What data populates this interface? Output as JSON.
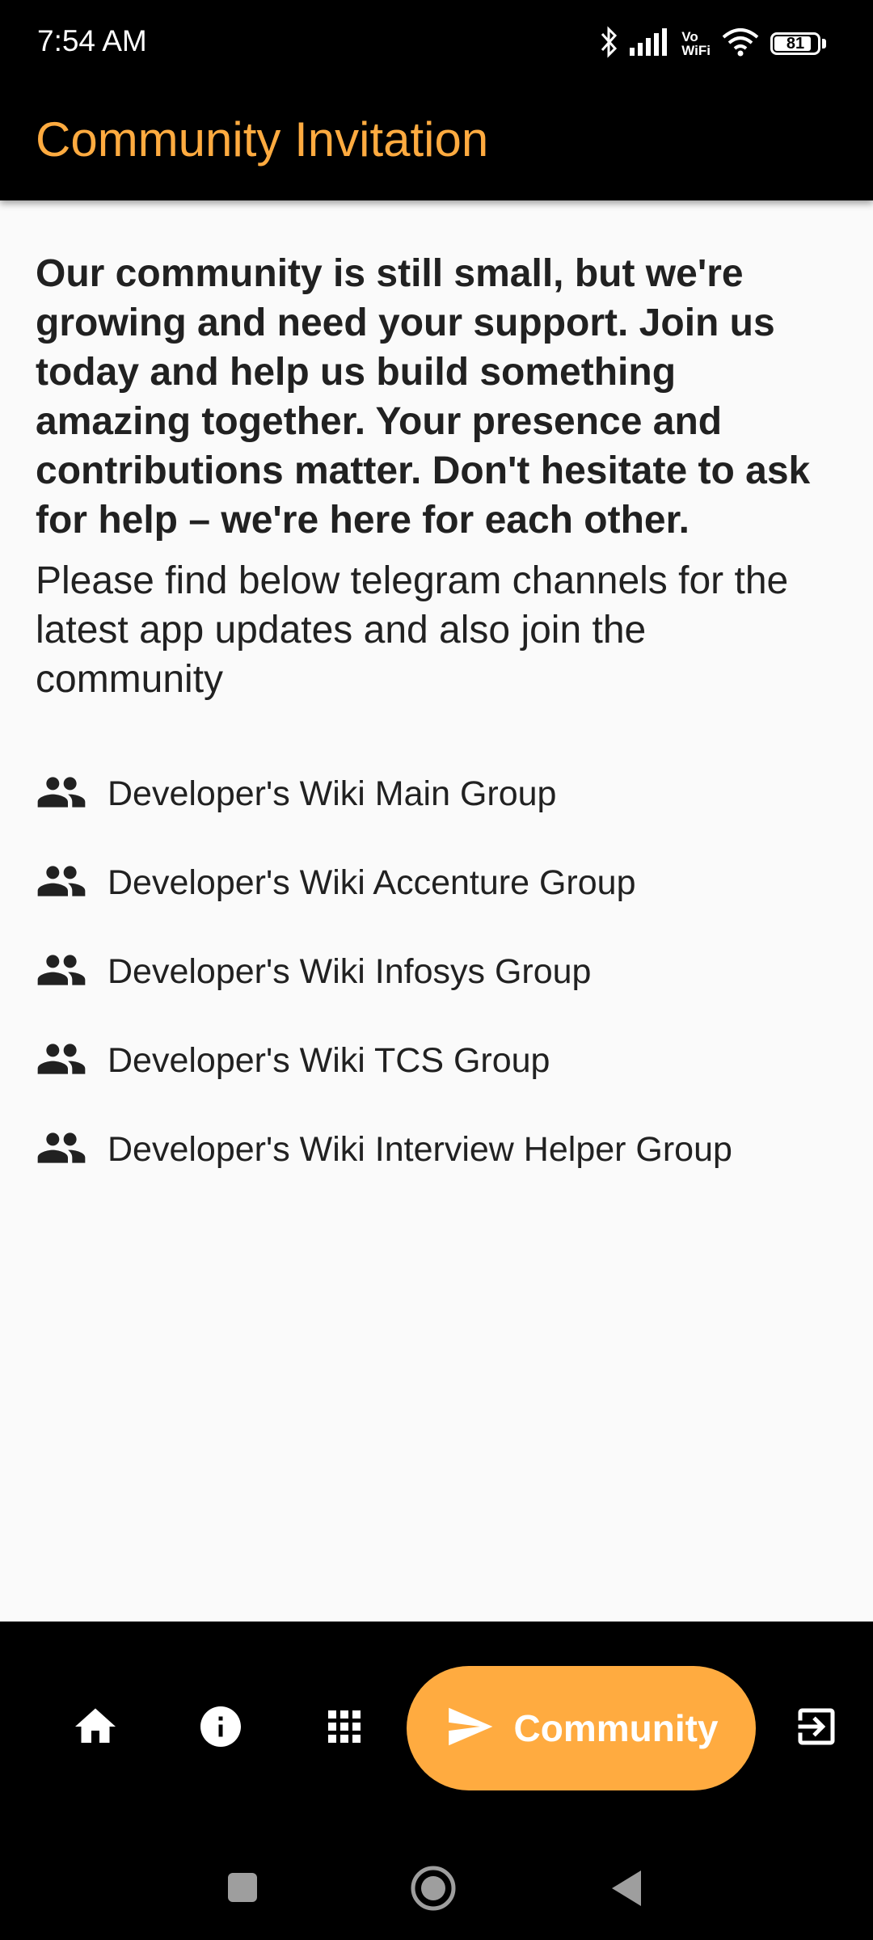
{
  "status_bar": {
    "time": "7:54 AM",
    "vowifi_top": "Vo",
    "vowifi_bottom": "WiFi",
    "battery": "81",
    "icons": [
      "bluetooth-icon",
      "signal-icon",
      "vowifi-icon",
      "wifi-icon",
      "battery-icon"
    ]
  },
  "app_bar": {
    "title": "Community Invitation"
  },
  "content": {
    "intro": "Our community is still small, but we're growing and need your support. Join us today and help us build something amazing together. Your presence and contributions matter. Don't hesitate to ask for help – we're here for each other.",
    "subtitle": "Please find below telegram channels for the latest app updates and also join the community",
    "groups": [
      {
        "label": "Developer's Wiki Main Group",
        "icon": "people-icon"
      },
      {
        "label": "Developer's Wiki Accenture Group",
        "icon": "people-icon"
      },
      {
        "label": "Developer's Wiki Infosys Group",
        "icon": "people-icon"
      },
      {
        "label": "Developer's Wiki TCS Group",
        "icon": "people-icon"
      },
      {
        "label": "Developer's Wiki Interview Helper Group",
        "icon": "people-icon"
      }
    ]
  },
  "bottom_nav": {
    "items": [
      "home-icon",
      "info-icon",
      "apps-grid-icon",
      "send-icon",
      "logout-icon"
    ],
    "active_label": "Community"
  },
  "system_nav": [
    "recents-button",
    "home-button",
    "back-button"
  ],
  "colors": {
    "accent": "#ffab40",
    "bar_background": "#000000",
    "page_background": "#fafafa",
    "text": "#212121"
  }
}
